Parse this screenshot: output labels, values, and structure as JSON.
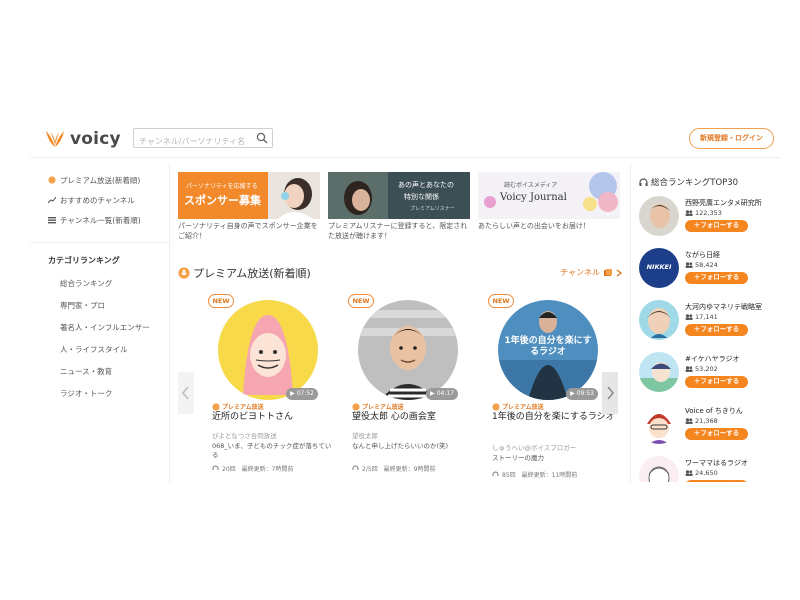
{
  "header": {
    "logo_text": "voicy",
    "search_placeholder": "チャンネル/パーソナリティ名",
    "login_label": "新規登録・ログイン"
  },
  "sidebar": {
    "nav": [
      {
        "label": "プレミアム放送(新着順)",
        "icon": "premium-icon"
      },
      {
        "label": "おすすめのチャンネル",
        "icon": "trend-icon"
      },
      {
        "label": "チャンネル一覧(新着順)",
        "icon": "list-icon"
      }
    ],
    "category_title": "カテゴリランキング",
    "categories": [
      "総合ランキング",
      "専門家・プロ",
      "著名人・インフルエンサー",
      "人・ライフスタイル",
      "ニュース・教育",
      "ラジオ・トーク"
    ]
  },
  "banners": [
    {
      "text_line1": "パーソナリティを応援する",
      "text_line2": "スポンサー募集",
      "caption": "パーソナリティ自身の声でスポンサー企業をご紹介！"
    },
    {
      "text_line1": "あの声とあなたの",
      "text_line2": "特別な関係",
      "text_line3": "プレミアムリスナー",
      "caption": "プレミアムリスナーに登録すると、限定された放送が聴けます！"
    },
    {
      "text_line1": "読むボイスメディア",
      "text_line2": "Voicy Journal",
      "caption": "あたらしい声との出会いをお届け！"
    }
  ],
  "section": {
    "title": "プレミアム放送(新着順)",
    "channel_link": "チャンネル"
  },
  "cards": [
    {
      "badge": "NEW",
      "duration": "07:52",
      "premium_label": "プレミアム放送",
      "title": "近所のピヨトトさん",
      "author": "ぴよとなつさ合同放送",
      "desc": "068_いま、子どものチック症が落ちている",
      "meta": "20回　最終更新：7時間前"
    },
    {
      "badge": "NEW",
      "duration": "04:17",
      "premium_label": "プレミアム放送",
      "title": "望役太郎 心の画会室",
      "author": "望役太郎",
      "desc": "なんと申し上げたらいいのか(笑)",
      "meta": "2/5回　最終更新：9時間前"
    },
    {
      "badge": "NEW",
      "duration": "09:53",
      "premium_label": "プレミアム放送",
      "title": "1年後の自分を楽にするラジオ",
      "author": "しゅうへい@ボイスブロガー",
      "desc": "ストーリーの魔力",
      "meta": "85回　最終更新：11時間前",
      "thumb_text": "1年後の自分を楽にするラジオ"
    }
  ],
  "ranking": {
    "title": "総合ランキングTOP30",
    "follow_label": "＋フォローする",
    "items": [
      {
        "name": "西野亮廣エンタメ研究所",
        "count": "122,353"
      },
      {
        "name": "ながら日経",
        "count": "58,424",
        "logo_text": "NIKKEI"
      },
      {
        "name": "大河内ゆマネリテ戦略室",
        "count": "17,141"
      },
      {
        "name": "#イケハヤラジオ",
        "count": "53,202"
      },
      {
        "name": "Voice of ちきりん",
        "count": "21,368"
      },
      {
        "name": "ワーママはるラジオ",
        "count": "24,650"
      }
    ]
  },
  "colors": {
    "accent": "#f5851e",
    "accent_text": "#e07820",
    "border": "#eeeeee"
  }
}
